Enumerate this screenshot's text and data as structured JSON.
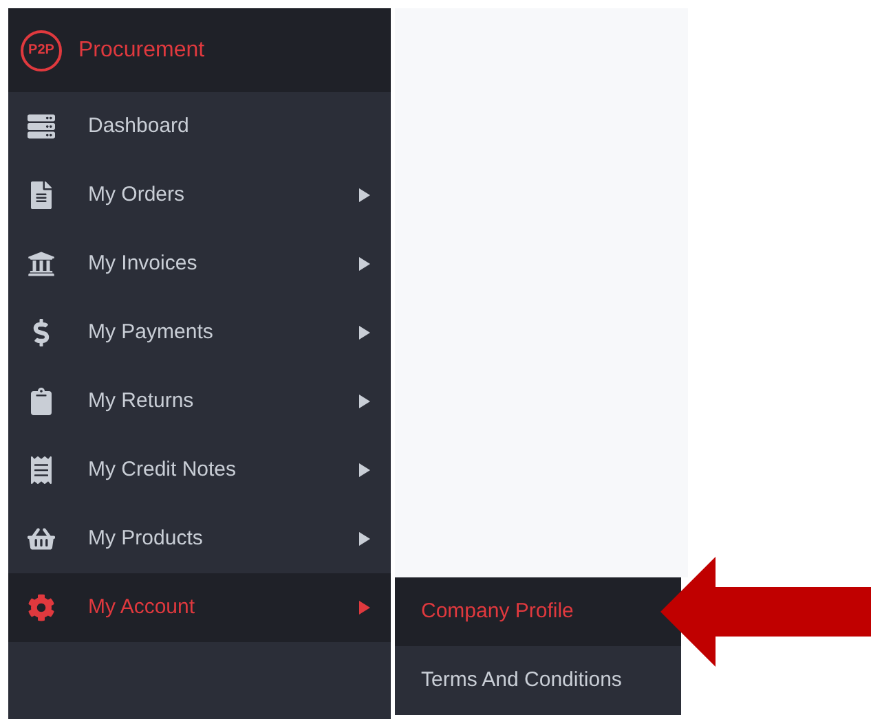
{
  "sidebar": {
    "brand": {
      "logo": "P2P",
      "title": "Procurement"
    },
    "items": [
      {
        "label": "Dashboard",
        "has_submenu": false,
        "selected": false
      },
      {
        "label": "My Orders",
        "has_submenu": true,
        "selected": false
      },
      {
        "label": "My Invoices",
        "has_submenu": true,
        "selected": false
      },
      {
        "label": "My Payments",
        "has_submenu": true,
        "selected": false
      },
      {
        "label": "My Returns",
        "has_submenu": true,
        "selected": false
      },
      {
        "label": "My Credit Notes",
        "has_submenu": true,
        "selected": false
      },
      {
        "label": "My Products",
        "has_submenu": true,
        "selected": false
      },
      {
        "label": "My Account",
        "has_submenu": true,
        "selected": true
      }
    ]
  },
  "submenu": {
    "items": [
      {
        "label": "Company Profile",
        "selected": true
      },
      {
        "label": "Terms And Conditions",
        "selected": false
      }
    ]
  }
}
